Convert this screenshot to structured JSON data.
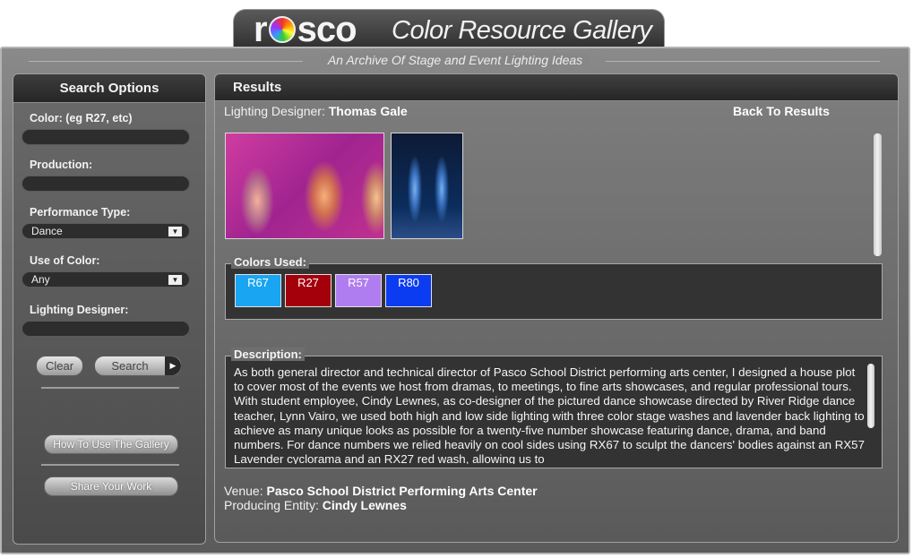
{
  "header": {
    "logo": {
      "r": "r",
      "o_icon": "color-wheel-o",
      "sco": "sco"
    },
    "title": "Color Resource Gallery",
    "subtitle": "An Archive Of Stage and Event Lighting Ideas"
  },
  "search": {
    "heading": "Search Options",
    "color": {
      "label": "Color: (eg R27, etc)",
      "value": ""
    },
    "production": {
      "label": "Production:",
      "value": ""
    },
    "performance_type": {
      "label": "Performance Type:",
      "value": "Dance"
    },
    "use_of_color": {
      "label": "Use of Color:",
      "value": "Any"
    },
    "lighting_designer": {
      "label": "Lighting Designer:",
      "value": ""
    },
    "clear_label": "Clear",
    "search_label": "Search",
    "how_to_label": "How To Use The Gallery",
    "share_label": "Share Your Work"
  },
  "results": {
    "heading": "Results",
    "designer_label": "Lighting Designer: ",
    "designer_name": "Thomas Gale",
    "back_label": "Back To Results",
    "colors_legend": "Colors Used:",
    "colors": [
      {
        "code": "R67",
        "color": "#1aa5f2"
      },
      {
        "code": "R27",
        "color": "#a3000c"
      },
      {
        "code": "R57",
        "color": "#b07df0"
      },
      {
        "code": "R80",
        "color": "#0c3cf2"
      }
    ],
    "description_legend": "Description:",
    "description": "As both general director and technical director of Pasco School District performing arts center, I designed a house plot to cover most of the events we host from dramas, to meetings, to fine arts showcases, and regular professional tours. With student employee, Cindy Lewnes, as co-designer of the pictured dance showcase directed by River Ridge dance teacher, Lynn Vairo, we used both high and low side lighting with three color stage washes and lavender back lighting to achieve as many unique looks as possible for a twenty-five number showcase featuring dance, drama, and band numbers. For dance numbers we relied heavily on cool sides using RX67 to sculpt the dancers' bodies against an RX57 Lavender cyclorama and an RX27 red wash, allowing us to",
    "venue_label": "Venue: ",
    "venue": "Pasco School District Performing Arts Center",
    "producer_label": "Producing Entity: ",
    "producer": "Cindy Lewnes"
  }
}
